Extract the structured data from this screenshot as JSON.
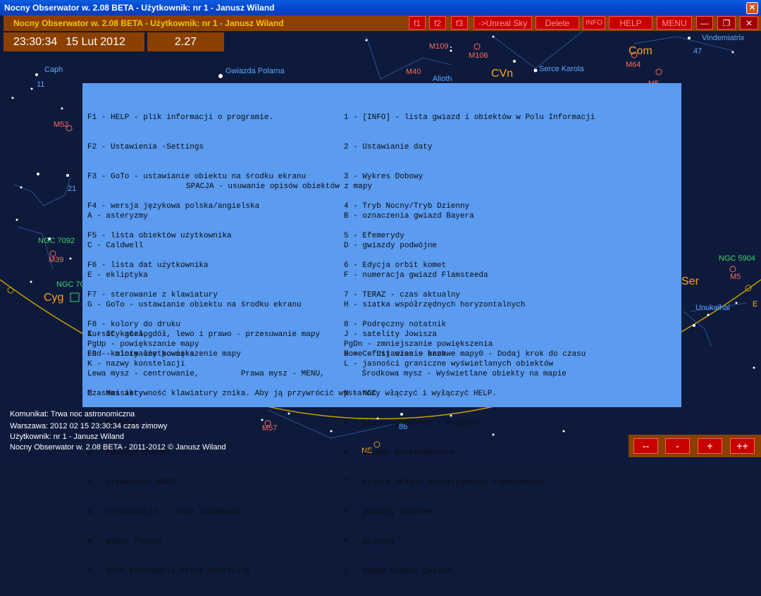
{
  "window": {
    "title": "Nocny Obserwator w. 2.08 BETA -  Użytkownik:  nr 1 - Janusz Wiland",
    "close": "✕"
  },
  "toolbar": {
    "title": "Nocny Obserwator w. 2.08 BETA -  Użytkownik:  nr 1 - Janusz Wiland",
    "buttons": {
      "f1": "f1",
      "f2": "f2",
      "f3": "f3",
      "unreal": "->Unreal Sky",
      "delete": "Delete",
      "info": "INFO",
      "help": "HELP",
      "menu": "MENU",
      "minimize": "—",
      "maximize": "❐",
      "close": "✕"
    }
  },
  "time": {
    "clock": "23:30:34",
    "date": "15 Lut 2012",
    "value": "2.27"
  },
  "sky_labels": {
    "caph": "Caph",
    "n11": "11",
    "gwiazda_polarna": "Gwiazda Polarna",
    "m52": "M52",
    "n21": "21",
    "ngc7092": "NGC 7092",
    "m39": "M39",
    "ngc70": "NGC 70",
    "cyg": "Cyg",
    "m109": "M109",
    "m106": "M106",
    "m40": "M40",
    "alioth": "Alioth",
    "cvn": "CVn",
    "serce_karola": "Serce Karola",
    "m64": "M64",
    "com": "Com",
    "vindemiatrix": "Vindemiatrix",
    "n47": "47",
    "m53": "M5",
    "ngc5904": "NGC 5904",
    "m5": "M5",
    "ser": "Ser",
    "unukalhai": "Unukalhai",
    "m57": "M57",
    "n86": "86",
    "ne": "NE",
    "e": "E"
  },
  "help": {
    "lines_left": [
      "F1 - HELP - plik informacji o programie.",
      "F2 - Ustawienia -Settings",
      "F3 - GoTo - ustawianie obiektu na środku ekranu",
      "F4 - wersja językowa polska/angielska",
      "F5 - lista obiektów użytkownika",
      "F6 - lista dat użytkownika",
      "F7 - sterowanie z klawiatury",
      "F8 - kolory do druku",
      "F9 - kolory użytkownika"
    ],
    "lines_right": [
      "1 - [INFO] - lista gwiazd i obiektów w Polu Informacji",
      "2 - Ustawianie daty",
      "3 - Wykres Dobowy",
      "4 - Tryb Nocny/Tryb Dzienny",
      "5 - Efemerydy",
      "6 - Edycja orbit komet",
      "7 - TERAZ - czas aktualny",
      "8 - Podręczny notatnik",
      "9 - Cofnij czas o krok       0 - Dodaj krok do czasu"
    ],
    "spacja": "SPACJA - usuwanie opisów obiektów z mapy",
    "letters_left": [
      "A - asteryzmy",
      "C - Caldwell",
      "E - ekliptyka",
      "G - GoTo - ustawianie obiektu na środku ekranu",
      "I - IC katalog",
      "K - nazwy konstelacji",
      "M - Messiery",
      "O - FUNKCJE",
      "Q - funkcja OCCULT",
      "S - Ustawienia MAPY",
      "U - Urbanizacja - linia zabudowań",
      "W - wybór fontów",
      "Y - Pole Informacji/Krzyż Centralny"
    ],
    "letters_right": [
      "B - oznaczenia gwiazd Bayera",
      "D - gwiazdy podwójne",
      "F - numeracja gwiazd Flamsteeda",
      "H - siatka współrzędnych horyzontalnych",
      "J - satelity Jowisza",
      "L - jasności graniczne wyświetlanych obiektów",
      "N - NGC",
      "P - planety, Słońce i Księżyc",
      "R - stoper astronomiczny",
      "T - siatka układu współrzędnych równikowych",
      "V - gwiazdy zmienne",
      "X - pulsary",
      "Z - nazwy własne gwiazd"
    ],
    "cursors": "Kursory góra, dół, lewo i prawo - przesuwanie mapy",
    "pgup": "PgUp - powiększanie mapy",
    "pgdn": "PgDn - zmniejszanie powiększenia",
    "end": "End - minimalne powiększenie mapy",
    "home": "Home - Ustawienie bazowe mapy",
    "mouse": "Lewa mysz - centrowanie,         Prawa mysz - MENU,        Środkowa mysz - Wyświetlane obiekty na mapie",
    "note": "Czasami aktywność klawiatury znika. Aby ją przywrócić wystarczy włączyć i wyłączyć HELP."
  },
  "status": {
    "komunikat": "Komunikat: Trwa noc astronomiczna",
    "location": "Warszawa:  2012 02 15  23:30:34 czas zimowy",
    "user": "Użytkownik:  nr 1 - Janusz Wiland",
    "copyright": "Nocny Obserwator w. 2.08 BETA - 2011-2012 © Janusz Wiland"
  },
  "zoom": {
    "zoom_out_max": "--",
    "zoom_out": "-",
    "zoom_in": "+",
    "zoom_in_max": "++"
  },
  "colors": {
    "accent": "#8c4000",
    "button": "#c80000",
    "help_bg": "#5b9bf0",
    "sky": "#0e1a3c"
  }
}
